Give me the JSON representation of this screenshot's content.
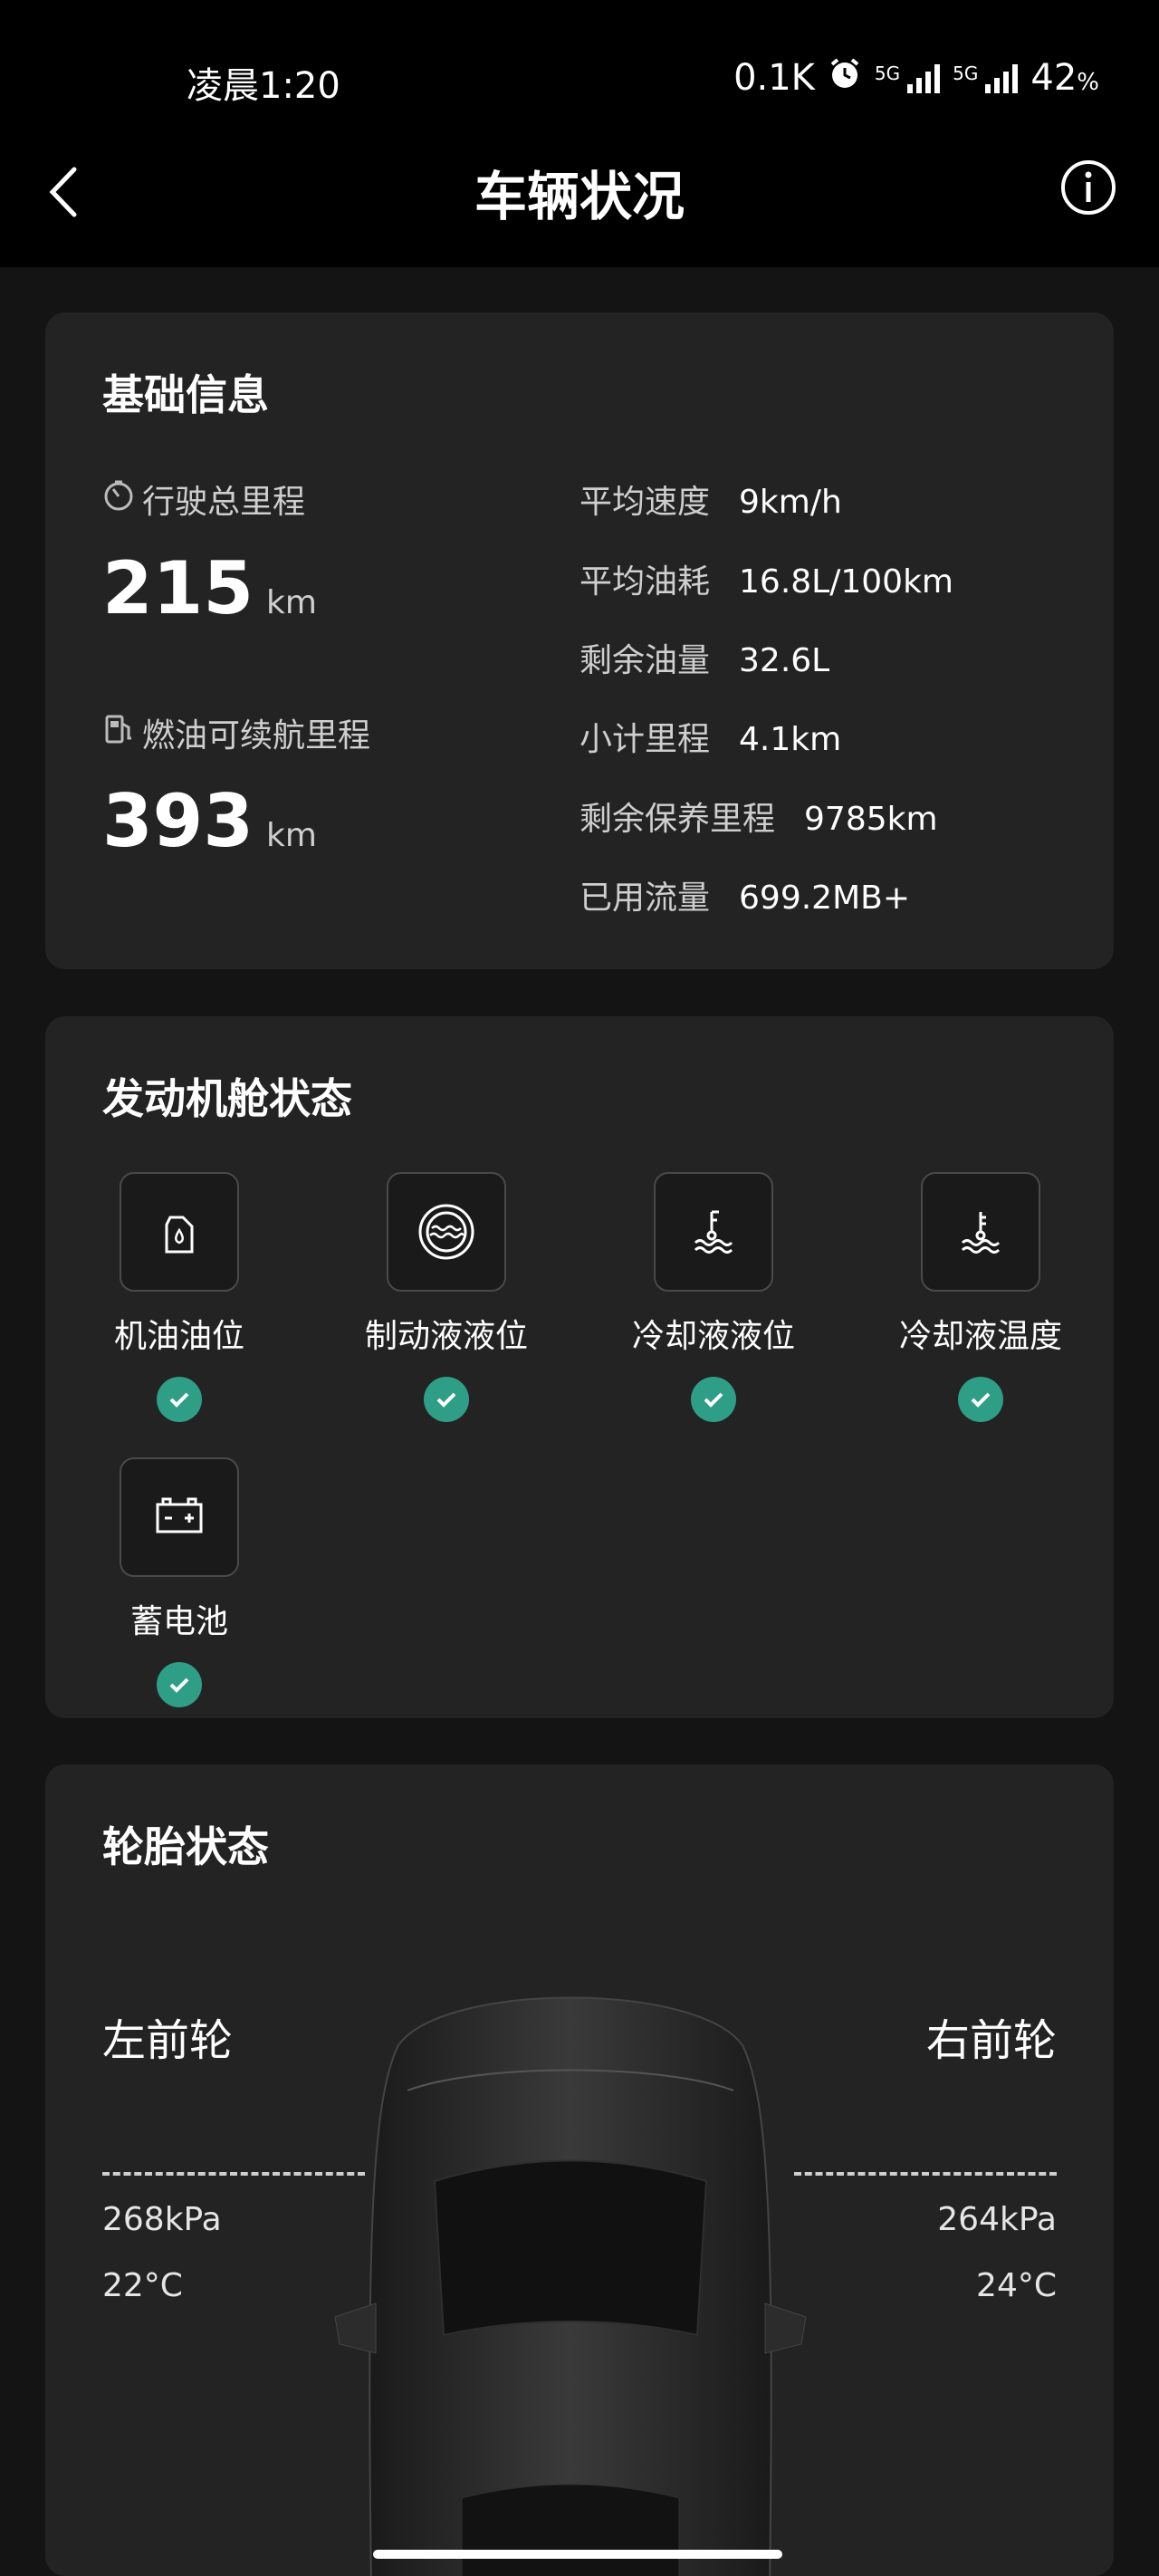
{
  "status": {
    "time": "凌晨1:20",
    "net_speed": "0.1K",
    "sig1": "5G",
    "sig2": "5G",
    "battery": "42",
    "battery_unit": "%"
  },
  "header": {
    "title": "车辆状况"
  },
  "basic": {
    "title": "基础信息",
    "total_mileage_label": "行驶总里程",
    "total_mileage_value": "215",
    "total_mileage_unit": "km",
    "range_label": "燃油可续航里程",
    "range_value": "393",
    "range_unit": "km",
    "stats": [
      {
        "k": "平均速度",
        "v": "9km/h"
      },
      {
        "k": "平均油耗",
        "v": "16.8L/100km"
      },
      {
        "k": "剩余油量",
        "v": "32.6L"
      },
      {
        "k": "小计里程",
        "v": "4.1km"
      },
      {
        "k": "剩余保养里程",
        "v": "9785km"
      },
      {
        "k": "已用流量",
        "v": "699.2MB+"
      }
    ]
  },
  "engine": {
    "title": "发动机舱状态",
    "items": [
      {
        "label": "机油油位",
        "icon": "oil-can-icon"
      },
      {
        "label": "制动液液位",
        "icon": "brake-fluid-icon"
      },
      {
        "label": "冷却液液位",
        "icon": "coolant-level-icon"
      },
      {
        "label": "冷却液温度",
        "icon": "coolant-temp-icon"
      },
      {
        "label": "蓄电池",
        "icon": "battery-icon"
      }
    ]
  },
  "tires": {
    "title": "轮胎状态",
    "front_left": {
      "name": "左前轮",
      "pressure": "268kPa",
      "temp": "22°C"
    },
    "front_right": {
      "name": "右前轮",
      "pressure": "264kPa",
      "temp": "24°C"
    }
  },
  "colors": {
    "accent_ok": "#2f9e86",
    "card": "#232323",
    "bg": "#141414"
  }
}
